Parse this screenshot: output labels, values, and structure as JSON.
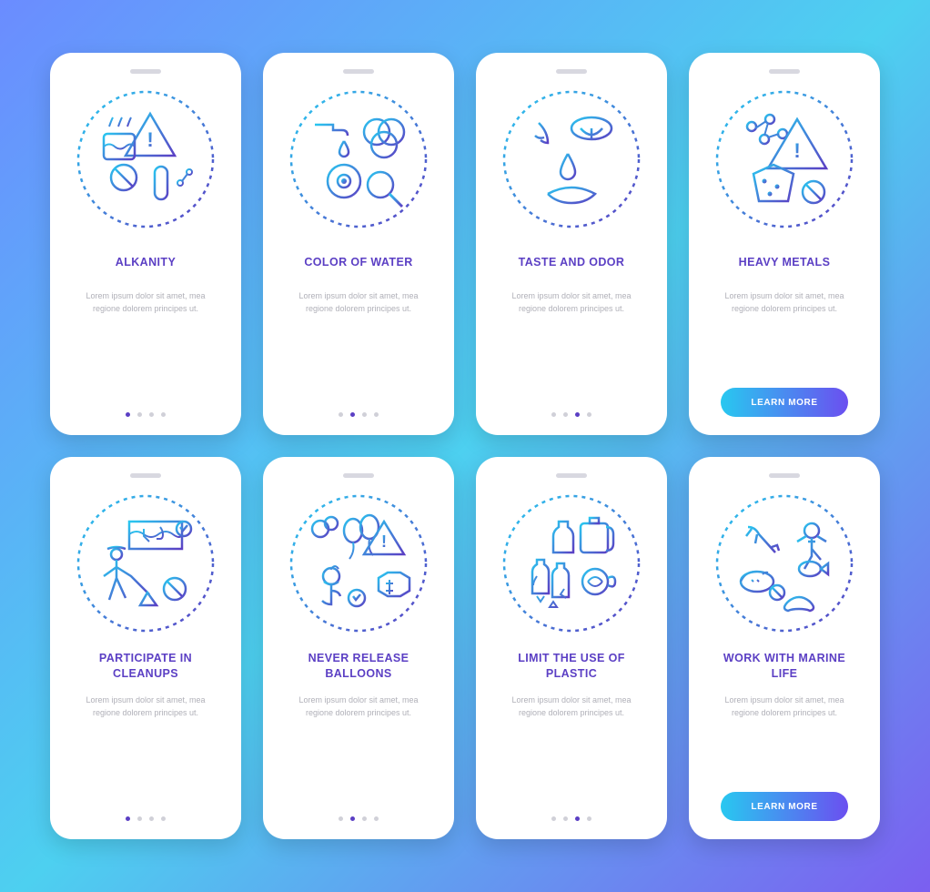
{
  "rows": [
    {
      "cards": [
        {
          "title": "ALKANITY",
          "desc": "Lorem ipsum dolor sit amet, mea regione dolorem principes ut.",
          "activeDot": 0,
          "hasCta": false,
          "icon": "alkanity"
        },
        {
          "title": "COLOR OF WATER",
          "desc": "Lorem ipsum dolor sit amet, mea regione dolorem principes ut.",
          "activeDot": 1,
          "hasCta": false,
          "icon": "color"
        },
        {
          "title": "TASTE AND ODOR",
          "desc": "Lorem ipsum dolor sit amet, mea regione dolorem principes ut.",
          "activeDot": 2,
          "hasCta": false,
          "icon": "taste"
        },
        {
          "title": "HEAVY METALS",
          "desc": "Lorem ipsum dolor sit amet, mea regione dolorem principes ut.",
          "activeDot": 3,
          "hasCta": true,
          "cta": "LEARN MORE",
          "icon": "metals"
        }
      ]
    },
    {
      "cards": [
        {
          "title": "PARTICIPATE IN CLEANUPS",
          "desc": "Lorem ipsum dolor sit amet, mea regione dolorem principes ut.",
          "activeDot": 0,
          "hasCta": false,
          "icon": "cleanups"
        },
        {
          "title": "NEVER RELEASE BALLOONS",
          "desc": "Lorem ipsum dolor sit amet, mea regione dolorem principes ut.",
          "activeDot": 1,
          "hasCta": false,
          "icon": "balloons"
        },
        {
          "title": "LIMIT THE USE OF PLASTIC",
          "desc": "Lorem ipsum dolor sit amet, mea regione dolorem principes ut.",
          "activeDot": 2,
          "hasCta": false,
          "icon": "plastic"
        },
        {
          "title": "WORK WITH MARINE LIFE",
          "desc": "Lorem ipsum dolor sit amet, mea regione dolorem principes ut.",
          "activeDot": 3,
          "hasCta": true,
          "cta": "LEARN MORE",
          "icon": "marine"
        }
      ]
    }
  ],
  "dotCount": 4,
  "colors": {
    "accent": "#5b3fc4",
    "grad1": "#28c8f0",
    "grad2": "#6b4ff0"
  },
  "icons": {
    "alkanity": "warning-icon",
    "color": "color-icon",
    "taste": "taste-icon",
    "metals": "metals-icon",
    "cleanups": "cleanup-icon",
    "balloons": "balloon-icon",
    "plastic": "plastic-icon",
    "marine": "marine-icon"
  }
}
